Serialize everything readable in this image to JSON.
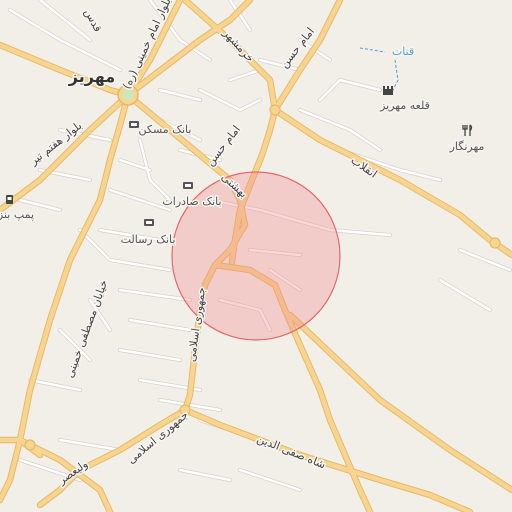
{
  "city": {
    "name": "مهریز"
  },
  "pois": {
    "bank_maskan": "بانک مسکن",
    "bank_saderat": "بانک صادرات",
    "bank_resalat": "بانک رسالت",
    "gas_station": "پمپ بنز",
    "castle": "قلعه مهریز",
    "mehrnegar": "مهرنگار"
  },
  "water": {
    "qanat": "قنات"
  },
  "roads": {
    "imam_hasan_1": "امام حسن",
    "imam_hasan_2": "امام حسن",
    "imam_khomeini": "بلوار امام خمینی (ره)",
    "khorramshahr": "خرمشهر",
    "enghelab": "انقلاب",
    "beheshti": "بهشتی",
    "haft_tir": "بلوار هفتم تیر",
    "mostafa_khomeini": "خیابان مصطفی خمینی",
    "jomhouri_1": "جمهوری اسلامی",
    "jomhouri_2": "جمهوری اسلامی",
    "shah_safi": "شاه صفی الدین",
    "valiasr": "ولیعصر",
    "ghods": "قدس"
  },
  "colors": {
    "land": "#f2efe9",
    "major_road": "#f8d58f",
    "major_road_casing": "#e6b96b",
    "minor_road": "#ffffff",
    "minor_road_casing": "#d6d2cc",
    "circle_fill": "#f28b8b",
    "circle_stroke": "#e36a6a",
    "water": "#5b9bd5"
  },
  "icons": {
    "bank": "bank-icon",
    "fuel": "fuel-pump-icon",
    "castle": "castle-icon",
    "restaurant": "restaurant-icon"
  }
}
